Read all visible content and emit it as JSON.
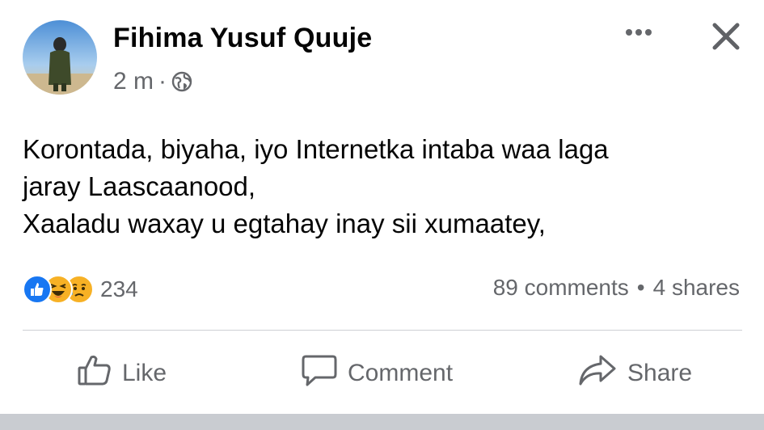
{
  "post": {
    "author": "Fihima Yusuf Quuje",
    "time": "2 m",
    "separator": "·",
    "lines": [
      "Korontada, biyaha, iyo Internetka intaba waa laga",
      "jaray Laascaanood,",
      "Xaaladu waxay u egtahay inay sii xumaatey,"
    ],
    "reaction_count": "234",
    "comments": "89 comments",
    "stats_separator": "•",
    "shares": "4 shares",
    "reactions": [
      "like-icon",
      "haha-icon",
      "sad-icon"
    ],
    "icons": {
      "privacy": "globe-icon",
      "more": "more-icon",
      "close": "close-icon"
    }
  },
  "actions": {
    "like": "Like",
    "comment": "Comment",
    "share": "Share"
  },
  "colors": {
    "like_blue": "#1877f2",
    "emoji_yellow": "#f7b125",
    "secondary_text": "#65676b"
  }
}
